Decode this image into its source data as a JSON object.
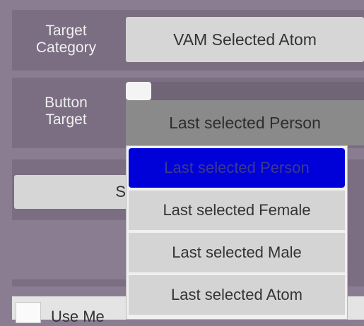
{
  "target_category": {
    "label_line1": "Target",
    "label_line2": "Category",
    "value": "VAM Selected Atom"
  },
  "button_target": {
    "label_line1": "Button",
    "label_line2": "Target",
    "value": "Last selected Person",
    "options": [
      {
        "label": "Last selected Person",
        "selected": true
      },
      {
        "label": "Last selected Female",
        "selected": false
      },
      {
        "label": "Last selected Male",
        "selected": false
      },
      {
        "label": "Last selected Atom",
        "selected": false
      }
    ]
  },
  "partial_button": {
    "label": "S"
  },
  "use_checkbox": {
    "label": "Use Me"
  },
  "colors": {
    "background": "#8a7d92",
    "panel": "#7b6d82",
    "dropdown_header": "#8a8a8a",
    "selected_option": "#0000d8"
  }
}
